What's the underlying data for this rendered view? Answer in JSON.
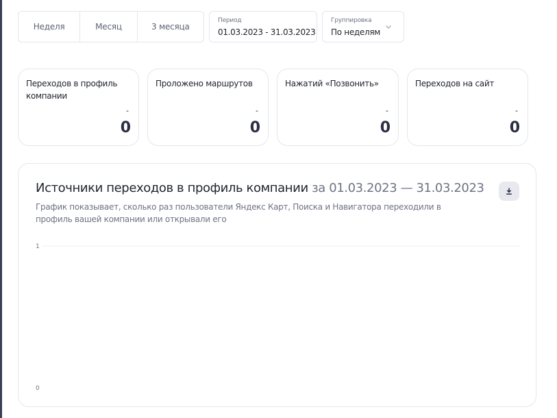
{
  "toolbar": {
    "periods": [
      {
        "label": "Неделя"
      },
      {
        "label": "Месяц"
      },
      {
        "label": "3 месяца"
      }
    ],
    "period": {
      "label": "Период",
      "value": "01.03.2023 - 31.03.2023"
    },
    "grouping": {
      "label": "Группировка",
      "value": "По неделям"
    }
  },
  "cards": [
    {
      "title": "Переходов в профиль компании",
      "delta": "-",
      "value": "0"
    },
    {
      "title": "Проложено маршрутов",
      "delta": "-",
      "value": "0"
    },
    {
      "title": "Нажатий «Позвонить»",
      "delta": "-",
      "value": "0"
    },
    {
      "title": "Переходов на сайт",
      "delta": "-",
      "value": "0"
    }
  ],
  "chart_panel": {
    "title": "Источники переходов в профиль компании",
    "title_range": " за 01.03.2023 — 31.03.2023",
    "subtitle": "График показывает, сколько раз пользователи Яндекс Карт, Поиска и Навигатора переходили в профиль вашей компании или открывали его",
    "download_icon": "download-icon"
  },
  "chart_data": {
    "type": "line",
    "title": "Источники переходов в профиль компании за 01.03.2023 — 31.03.2023",
    "xlabel": "",
    "ylabel": "",
    "ylim": [
      0,
      1
    ],
    "yticks": [
      "1",
      "0"
    ],
    "series": [],
    "grid": true
  },
  "colors": {
    "text": "#21252e",
    "muted": "#6e7383",
    "border": "#e4e6ec",
    "button_bg": "#e7e9ee"
  }
}
